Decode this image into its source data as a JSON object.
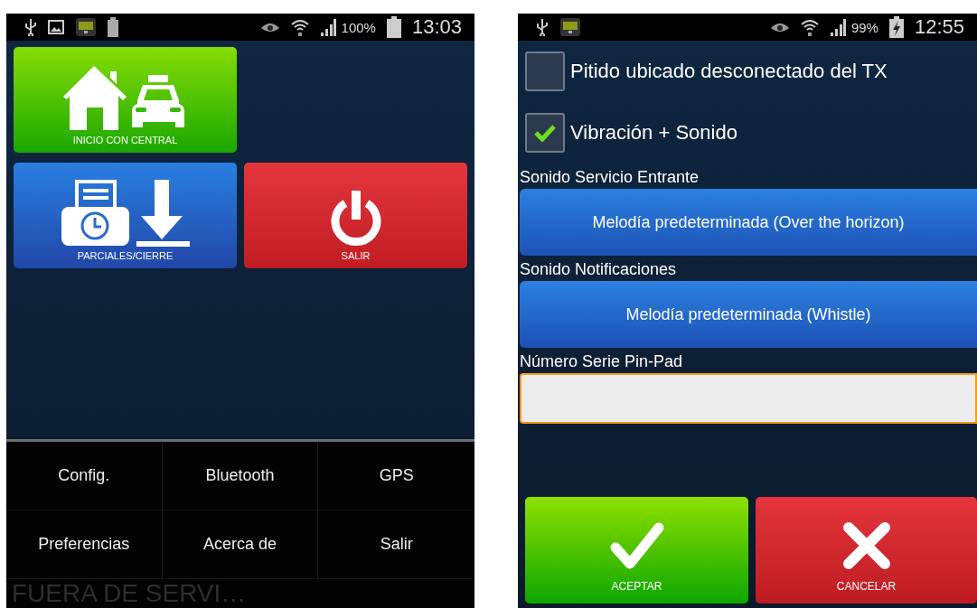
{
  "left_screen": {
    "status_bar": {
      "battery_percent": "100%",
      "time": "13:03",
      "charging": false
    },
    "tiles": [
      {
        "label": "INICIO CON CENTRAL",
        "kind": "home"
      },
      {
        "label": "PARCIALES/CIERRE",
        "kind": "report"
      },
      {
        "label": "SALIR",
        "kind": "exit"
      }
    ],
    "menu": [
      "Config.",
      "Bluetooth",
      "GPS",
      "Preferencias",
      "Acerca de",
      "Salir"
    ],
    "status_text": "FUERA DE SERVI…"
  },
  "right_screen": {
    "status_bar": {
      "battery_percent": "99%",
      "time": "12:55",
      "charging": true
    },
    "checkboxes": [
      {
        "label": "Pitido ubicado desconectado del TX",
        "checked": false
      },
      {
        "label": "Vibración + Sonido",
        "checked": true
      }
    ],
    "settings": [
      {
        "kind": "sound",
        "label": "Sonido Servicio Entrante",
        "value": "Melodía predeterminada (Over the horizon)"
      },
      {
        "kind": "sound",
        "label": "Sonido Notificaciones",
        "value": "Melodía predeterminada (Whistle)"
      },
      {
        "kind": "text",
        "label": "Número Serie Pin-Pad",
        "focused": true
      }
    ],
    "actions": [
      {
        "label": "ACEPTAR",
        "kind": "accept"
      },
      {
        "label": "CANCELAR",
        "kind": "cancel"
      }
    ]
  }
}
